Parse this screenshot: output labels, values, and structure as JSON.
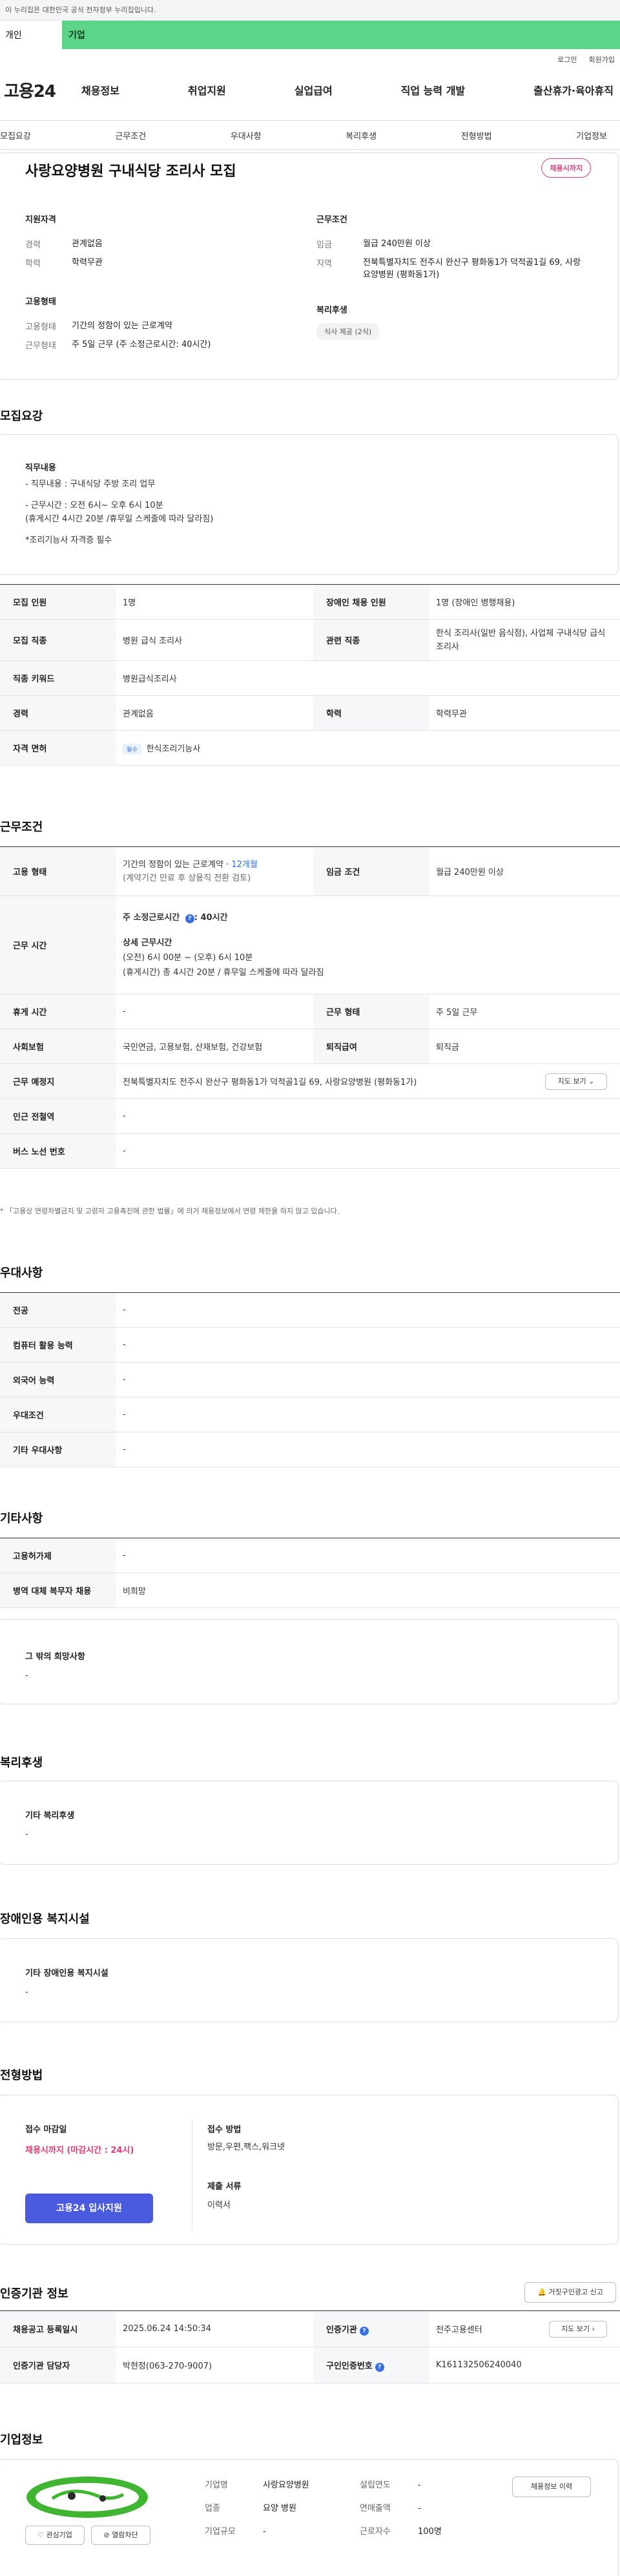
{
  "gov_banner": "이 누리집은 대한민국 공식 전자정부 누리집입니다.",
  "top_tabs": [
    "개인",
    "기업"
  ],
  "util_links": [
    "로그인",
    "회원가입"
  ],
  "logo": "고용24",
  "main_nav": [
    "채용정보",
    "취업지원",
    "실업급여",
    "직업 능력 개발",
    "출산휴가·육아휴직"
  ],
  "sub_nav": [
    "모집요강",
    "근무조건",
    "우대사항",
    "복리후생",
    "전형방법",
    "기업정보"
  ],
  "job": {
    "title": "사랑요양병원 구내식당 조리사 모집",
    "dday_badge": "채용시까지",
    "qual_title": "지원자격",
    "career_k": "경력",
    "career_v": "관계없음",
    "edu_k": "학력",
    "edu_v": "학력무관",
    "emp_title": "고용형태",
    "emptype_k": "고용형태",
    "emptype_v": "기간의 정함이 있는 근로계약",
    "worktype_k": "근무형태",
    "worktype_v": "주 5일 근무 (주 소정근로시간: 40시간)",
    "cond_title": "근무조건",
    "wage_k": "임금",
    "wage_v": "월급 240만원 이상",
    "area_k": "지역",
    "area_v": "전북특별자치도 전주시 완산구 평화동1가 덕적골1길 69, 사랑요양병원 (평화동1가)",
    "welf_title": "복리후생",
    "welf_chip": "식사 제공 (2식)"
  },
  "recruit": {
    "section_title": "모집요강",
    "duty_title": "직무내용",
    "duty_lines": [
      "- 직무내용 : 구내식당 주방 조리 업무",
      "",
      "- 근무시간 : 오전 6시~ 오후 6시 10분",
      "(휴게시간 4시간 20분 /휴무일 스케줄에 따라 달라짐)",
      "",
      "*조리기능사 자격증 필수"
    ],
    "table": {
      "r1": [
        "모집 인원",
        "1명",
        "장애인 채용 인원",
        "1명 (장애인 병행채용)"
      ],
      "r2": [
        "모집 직종",
        "병원 급식 조리사",
        "관련 직종",
        "한식 조리사(일반 음식점), 사업체 구내식당 급식 조리사"
      ],
      "r3": [
        "직종 키워드",
        "병원급식조리사"
      ],
      "r4": [
        "경력",
        "관계없음",
        "학력",
        "학력무관"
      ],
      "r5": [
        "자격 면허",
        "필수",
        "한식조리기능사"
      ]
    }
  },
  "work": {
    "section_title": "근무조건",
    "emp_label": "고용 형태",
    "emp_line1_a": "기간의 정함이 있는 근로계약 · ",
    "emp_line1_b": "12개월",
    "emp_line2": "(계약기간 만료 후 상용직 전환 검토)",
    "wage_label": "임금 조건",
    "wage_value": "월급 240만원 이상",
    "hours_label": "근무 시간",
    "hours_main_a": "주 소정근로시간",
    "hours_main_b": ": 40시간",
    "hours_detail_title": "상세 근무시간",
    "hours_detail_1": "(오전) 6시 00분 ~ (오후) 6시 10분",
    "hours_detail_2": "(휴게시간) 총 4시간 20분 / 휴무일 스케줄에 따라 달라짐",
    "break_label": "휴게 시간",
    "break_value": "-",
    "form_label": "근무 형태",
    "form_value": "주 5일 근무",
    "ins_label": "사회보험",
    "ins_value": "국민연금, 고용보험, 산재보험, 건강보험",
    "sev_label": "퇴직급여",
    "sev_value": "퇴직금",
    "place_label": "근무 예정지",
    "place_value": "전북특별자치도 전주시 완산구 평화동1가 덕적골1길 69, 사랑요양병원 (평화동1가)",
    "map_btn": "지도 보기 ⌄",
    "subway_label": "인근 전철역",
    "subway_value": "-",
    "bus_label": "버스 노선 번호",
    "bus_value": "-",
    "footnote": "* 「고용상 연령차별금지 및 고령자 고용촉진에 관한 법률」에 의거 채용정보에서 연령 제한을 하지 않고 있습니다."
  },
  "pref": {
    "section_title": "우대사항",
    "rows": [
      [
        "전공",
        "-"
      ],
      [
        "컴퓨터 활용 능력",
        "-"
      ],
      [
        "외국어 능력",
        "-"
      ],
      [
        "우대조건",
        "-"
      ],
      [
        "기타 우대사항",
        "-"
      ]
    ]
  },
  "etc": {
    "section_title": "기타사항",
    "rows": [
      [
        "고용허가제",
        "-"
      ],
      [
        "병역 대체 복무자 채용",
        "비희망"
      ]
    ],
    "other_title": "그 밖의 희망사항",
    "other_value": "-"
  },
  "welfare": {
    "section_title": "복리후생",
    "box_title": "기타 복리후생",
    "box_value": "-"
  },
  "disab": {
    "section_title": "장애인용 복지시설",
    "box_title": "기타 장애인용 복지시설",
    "box_value": "-"
  },
  "process": {
    "section_title": "전형방법",
    "deadline_title": "접수 마감일",
    "deadline_value": "채용시까지 (마감시간 : 24시)",
    "apply_btn": "고용24 입사지원",
    "method_title": "접수 방법",
    "method_value": "방문,우편,팩스,워크넷",
    "docs_title": "제출 서류",
    "docs_value": "이력서"
  },
  "agency": {
    "section_title": "인증기관 정보",
    "report_btn": "거짓구인광고 신고",
    "r1": [
      "채용공고 등록일시",
      "2025.06.24 14:50:34",
      "인증기관",
      "전주고용센터"
    ],
    "map_btn": "지도 보기 ›",
    "r2": [
      "인증기관 담당자",
      "박현정(063-270-9007)",
      "구인인증번호",
      "K161132506240040"
    ]
  },
  "company": {
    "section_title": "기업정보",
    "name_k": "기업명",
    "name_v": "사랑요양병원",
    "found_k": "설립연도",
    "found_v": "-",
    "ind_k": "업종",
    "ind_v": "요양 병원",
    "sales_k": "연매출액",
    "sales_v": "-",
    "size_k": "기업규모",
    "size_v": "-",
    "emp_k": "근로자수",
    "emp_v": "100명",
    "fav_btn": "관심기업",
    "block_btn": "열람차단",
    "history_btn": "채용정보 이력"
  },
  "colors": {
    "accent_green": "#5cd58b",
    "pink": "#e23c7a",
    "blue": "#4a5be0"
  }
}
